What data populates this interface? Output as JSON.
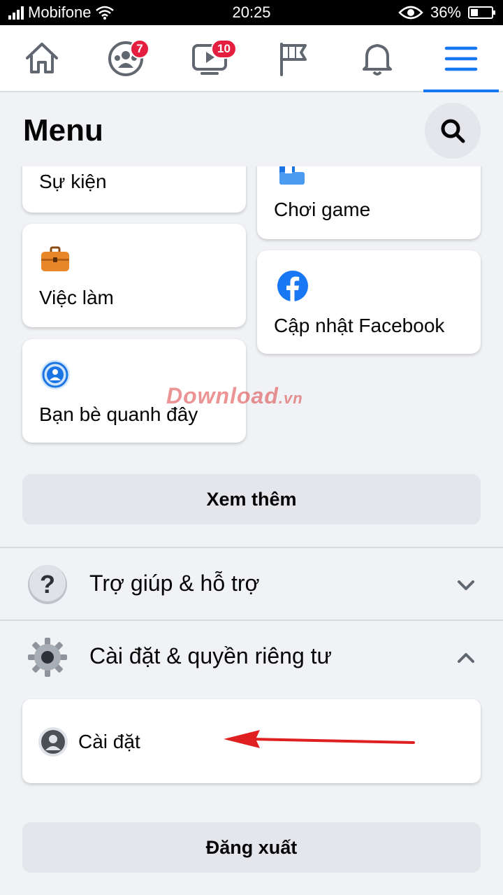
{
  "status_bar": {
    "carrier": "Mobifone",
    "time": "20:25",
    "battery": "36%",
    "battery_level": 0.36
  },
  "top_nav": {
    "items": [
      {
        "icon": "home-icon"
      },
      {
        "icon": "groups-icon",
        "badge": "7"
      },
      {
        "icon": "watch-icon",
        "badge": "10"
      },
      {
        "icon": "pages-flag-icon"
      },
      {
        "icon": "bell-icon"
      },
      {
        "icon": "menu-icon",
        "active": true
      }
    ]
  },
  "header": {
    "title": "Menu"
  },
  "shortcuts": {
    "events": "Sự kiện",
    "games": "Chơi game",
    "jobs": "Việc làm",
    "facebook_update": "Cập nhật Facebook",
    "nearby_friends": "Bạn bè quanh đây"
  },
  "see_more": "Xem thêm",
  "help_section": {
    "label": "Trợ giúp & hỗ trợ"
  },
  "settings_section": {
    "label": "Cài đặt & quyền riêng tư",
    "items": [
      {
        "label": "Cài đặt"
      }
    ]
  },
  "logout": "Đăng xuất",
  "watermark": {
    "text": "Download",
    "suffix": ".vn"
  },
  "colors": {
    "accent": "#1877f2",
    "badge": "#e41e3f",
    "background": "#f0f2f5",
    "annotation_arrow": "#e02020"
  }
}
